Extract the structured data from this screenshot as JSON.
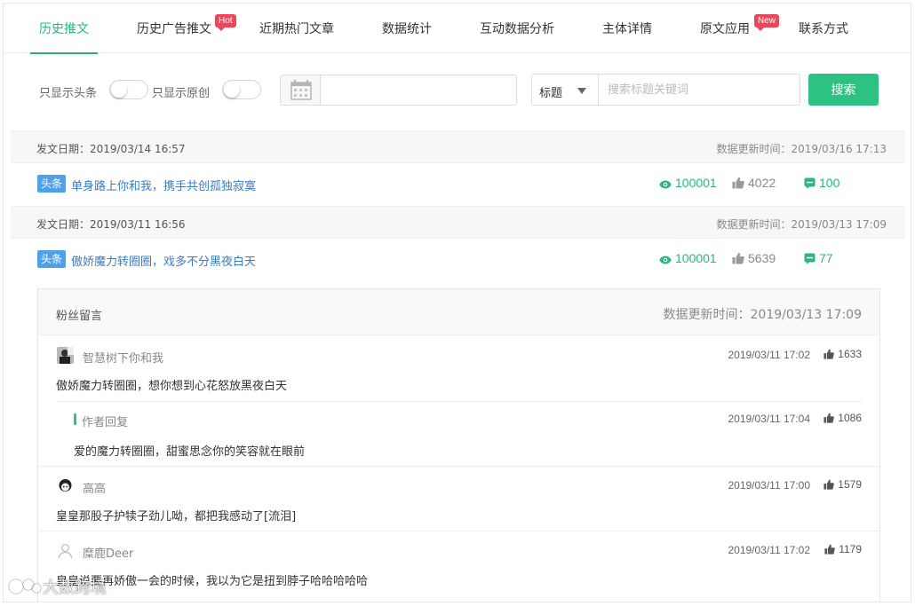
{
  "tabs": [
    {
      "label": "历史推文",
      "active": true
    },
    {
      "label": "历史广告推文",
      "badge": "Hot"
    },
    {
      "label": "近期热门文章"
    },
    {
      "label": "数据统计"
    },
    {
      "label": "互动数据分析"
    },
    {
      "label": "主体详情"
    },
    {
      "label": "原文应用",
      "badge": "New"
    },
    {
      "label": "联系方式"
    }
  ],
  "filters": {
    "only_headline_label": "只显示头条",
    "only_original_label": "只显示原创",
    "only_headline_on": false,
    "only_original_on": false,
    "select_value": "标题",
    "search_placeholder": "搜索标题关键词",
    "search_button": "搜索"
  },
  "articles": [
    {
      "date_label": "发文日期：2019/03/14 16:57",
      "updated_label": "数据更新时间：2019/03/16 17:13",
      "tag": "头条",
      "title": "单身路上你和我，携手共创孤独寂寞",
      "views": "100001",
      "likes": "4022",
      "comments": "100"
    },
    {
      "date_label": "发文日期：2019/03/11 16:56",
      "updated_label": "数据更新时间：2019/03/13 17:09",
      "tag": "头条",
      "title": "傲娇魔力转圈圈，戏多不分黑夜白天",
      "views": "100001",
      "likes": "5639",
      "comments": "77"
    }
  ],
  "comments_panel": {
    "title": "粉丝留言",
    "updated_label": "数据更新时间：2019/03/13 17:09",
    "comments": [
      {
        "user": "智慧树下你和我",
        "time": "2019/03/11 17:02",
        "likes": "1633",
        "text": "傲娇魔力转圈圈，想你想到心花怒放黑夜白天"
      },
      {
        "user": "作者回复",
        "time": "2019/03/11 17:04",
        "likes": "1086",
        "text": "爱的魔力转圈圈，甜蜜思念你的笑容就在眼前",
        "is_reply": true
      },
      {
        "user": "高高",
        "time": "2019/03/11 17:00",
        "likes": "1579",
        "text": "皇皇那股子护犊子劲儿呦，都把我感动了[流泪]"
      },
      {
        "user": "糜鹿Deer",
        "time": "2019/03/11 17:02",
        "likes": "1179",
        "text": "皇皇说要再娇傲一会的时候，我以为它是扭到脖子哈哈哈哈哈"
      }
    ]
  },
  "watermark": "大数跨境",
  "colors": {
    "accent": "#25b77e",
    "button": "#2dc284",
    "badge": "#e9485a",
    "tag": "#4ea1ea",
    "link": "#3b7cc2"
  }
}
